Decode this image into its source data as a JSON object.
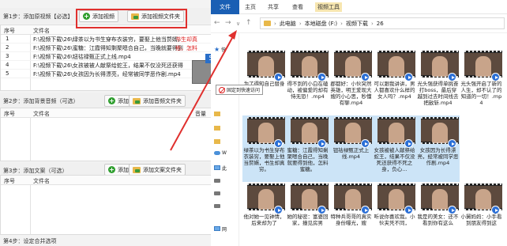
{
  "app": {
    "step1": {
      "title": "第1步：添加原视频【必选】",
      "add_video": "添加视频",
      "add_folder": "添加视频文件夹",
      "col_num": "序号",
      "col_name": "文件名",
      "rows": [
        {
          "num": "1",
          "name": "F:\\视频下载\\26\\绿茶以为书生穿布衣装穷，要娶上他当赘婿，",
          "tail": "书生却真"
        },
        {
          "num": "2",
          "name": "F:\\视频下载\\26\\蜜糖：江霞得知剩聚嗯合自己，当晚就要得到",
          "tail": "他，怎料"
        },
        {
          "num": "3",
          "name": "F:\\视频下载\\26\\钮祜禄甄正式上线.mp4",
          "tail": ""
        },
        {
          "num": "4",
          "name": "F:\\视频下载\\26\\女孩被被人献祭给蛇王，结果不仅没死还获得",
          "tail": ""
        },
        {
          "num": "5",
          "name": "F:\\视频下载\\26\\女孩因为长得漂亮，经常被同学恶作剧.mp4",
          "tail": ""
        }
      ]
    },
    "step2": {
      "title": "第2步：添加背景音频（可选）",
      "add_audio": "添加音频",
      "add_folder": "添加音频文件夹",
      "col_num": "序号",
      "col_name": "文件名",
      "col_volume": "音量"
    },
    "step3": {
      "title": "第3步：添加文案（可选）",
      "add_copy": "添加文案",
      "add_folder": "添加文案文件夹",
      "col_num": "序号",
      "col_name": "文件名"
    },
    "step4": {
      "title": "第4步：设定合并选项"
    },
    "drag_count": "5",
    "tooltip": "固定到快速访问"
  },
  "explorer": {
    "tabs": {
      "file": "文件",
      "home": "主页",
      "share": "共享",
      "view": "查看",
      "video_tools": "视频工具"
    },
    "path": [
      "此电脑",
      "本地磁盘 (F:)",
      "视频下载",
      "26"
    ],
    "nav": {
      "quick": "快",
      "w": "W",
      "pc": "此",
      "net": "网"
    },
    "files": [
      {
        "name": "为了得知自己替身",
        "sel": false
      },
      {
        "name": "得不到的小白在磕动，被偏爱的却有恃无恐！.mp4",
        "sel": false
      },
      {
        "name": "郡都好：小伙突然英雄，明王爱现大嫂的小心思，秒懂有聊.mp4",
        "sel": false
      },
      {
        "name": "可以跟我讲讲，男人都喜欢什么样的女人吗？.mp4",
        "sel": false
      },
      {
        "name": "光头强获得单挑奋打boss，最后穿越到过去时间线去把敌斩.mp4",
        "sel": false
      },
      {
        "name": "光头强开启了新的人生，却不认了的知道的一切！.mp4",
        "sel": false
      },
      {
        "name": "绿茶以为书生穿布衣装穷，要娶上他当赘婿，书生却真穷。",
        "sel": true
      },
      {
        "name": "蜜糖：江霞得知剩聚嗯合自己，当晚就要得到他，怎料蜜糖。",
        "sel": true
      },
      {
        "name": "钮祜禄甄正式上线.mp4",
        "sel": true
      },
      {
        "name": "女孩被被人献祭给蛇王，结果不仅没死还获得不死之身，负心…",
        "sel": true
      },
      {
        "name": "女孩因为长得漂亮，经常被同学恶作剧.mp4",
        "sel": true
      },
      {
        "name": "",
        "sel": false
      },
      {
        "name": "他对她一见钟情，后来却为了",
        "sel": false
      },
      {
        "name": "她的秘密：富婆回家，撞见房男",
        "sel": false
      },
      {
        "name": "特种兵哥哥的真实身份曝光，嫂",
        "sel": false
      },
      {
        "name": "听说你喜欢我。小伙夹凭不同，",
        "sel": false
      },
      {
        "name": "我是的美女：还不看到你有这么",
        "sel": false
      },
      {
        "name": "小舅妈妈：小手看到朋友得到这",
        "sel": false
      }
    ]
  }
}
